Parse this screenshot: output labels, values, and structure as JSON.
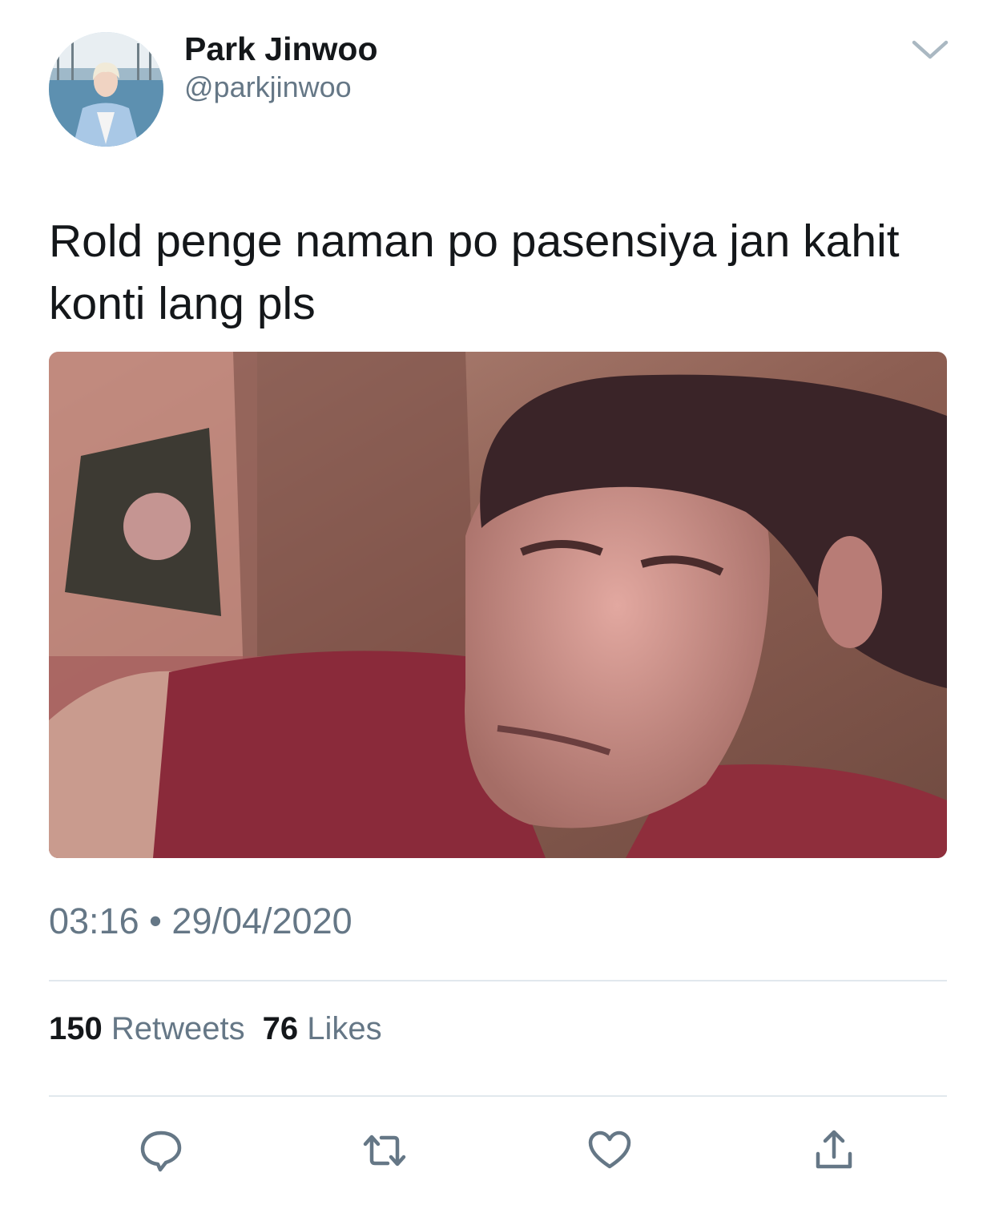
{
  "tweet": {
    "display_name": "Park Jinwoo",
    "handle": "@parkjinwoo",
    "text": "Rold penge naman po pasensiya jan kahit konti lang pls",
    "time": "03:16",
    "separator": "•",
    "date": "29/04/2020",
    "retweets_count": "150",
    "retweets_label": "Retweets",
    "likes_count": "76",
    "likes_label": "Likes"
  },
  "icons": {
    "menu": "chevron-down-icon",
    "reply": "reply-icon",
    "retweet": "retweet-icon",
    "like": "heart-icon",
    "share": "share-icon"
  },
  "colors": {
    "primary_text": "#14171a",
    "secondary_text": "#657786",
    "divider": "#e1e8ed",
    "icon": "#657786"
  }
}
